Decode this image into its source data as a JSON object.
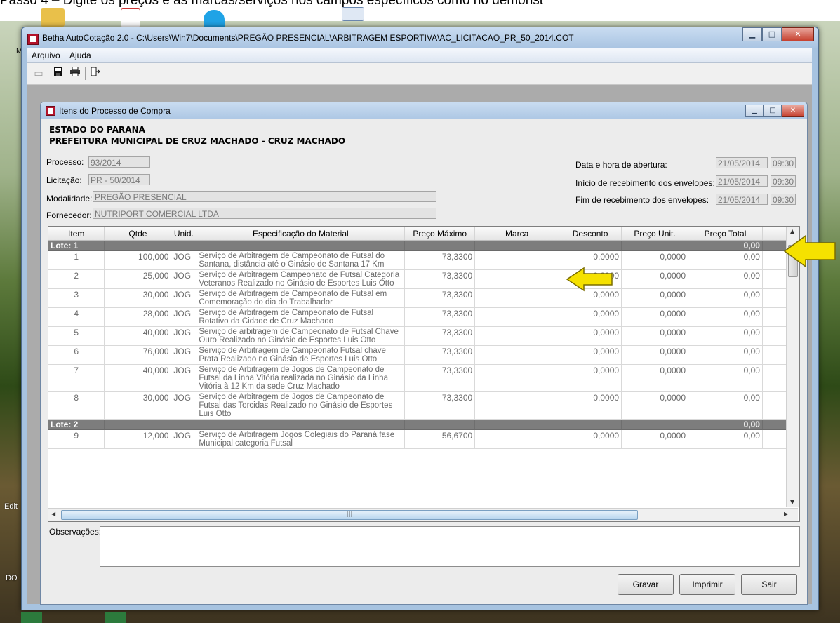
{
  "banner": {
    "text": "Passo 4 – Digite os preços e as marcas/serviços nos campos específicos como no demonst"
  },
  "desktop": {
    "labels": [
      "M",
      "Edit",
      "DO"
    ]
  },
  "window": {
    "title": "Betha AutoCotação 2.0 - C:\\Users\\Win7\\Documents\\PREGÃO PRESENCIAL\\ARBITRAGEM ESPORTIVA\\AC_LICITACAO_PR_50_2014.COT",
    "menu": [
      "Arquivo",
      "Ajuda"
    ],
    "toolbar": [
      "open-folder-icon",
      "save-icon",
      "print-icon",
      "exit-icon"
    ]
  },
  "child": {
    "title": "Itens do Processo de Compra",
    "header_line1": "ESTADO DO PARANA",
    "header_line2": "PREFEITURA MUNICIPAL DE CRUZ MACHADO - CRUZ MACHADO",
    "fields": {
      "processo_label": "Processo:",
      "processo": "93/2014",
      "licitacao_label": "Licitação:",
      "licitacao": "PR - 50/2014",
      "modalidade_label": "Modalidade:",
      "modalidade": "PREGÃO PRESENCIAL",
      "fornecedor_label": "Fornecedor:",
      "fornecedor": "NUTRIPORT COMERCIAL LTDA"
    },
    "dates": {
      "abertura_label": "Data e hora de abertura:",
      "abertura_data": "21/05/2014",
      "abertura_hora": "09:30",
      "inicio_label": "Início de recebimento dos envelopes:",
      "inicio_data": "21/05/2014",
      "inicio_hora": "09:30",
      "fim_label": "Fim de recebimento dos envelopes:",
      "fim_data": "21/05/2014",
      "fim_hora": "09:30"
    },
    "grid": {
      "columns": [
        "Item",
        "Qtde",
        "Unid.",
        "Especificação do Material",
        "Preço Máximo",
        "Marca",
        "Desconto",
        "Preço Unit.",
        "Preço Total"
      ],
      "lote1": {
        "label": "Lote: 1",
        "total": "0,00"
      },
      "lote2": {
        "label": "Lote: 2",
        "total": "0,00"
      },
      "rows": [
        {
          "item": "1",
          "qtde": "100,000",
          "unid": "JOG",
          "spec": "Serviço de Arbitragem de Campeonato de Futsal do Santana, distância até o Ginásio de Santana 17 Km",
          "preco_max": "73,3300",
          "marca": "",
          "desconto": "0,0000",
          "preco_unit": "0,0000",
          "preco_total": "0,00"
        },
        {
          "item": "2",
          "qtde": "25,000",
          "unid": "JOG",
          "spec": "Serviço de Arbitragem Campeonato de Futsal Categoria Veteranos Realizado no Ginásio de Esportes Luis Otto",
          "preco_max": "73,3300",
          "marca": "",
          "desconto": "0,0000",
          "preco_unit": "0,0000",
          "preco_total": "0,00"
        },
        {
          "item": "3",
          "qtde": "30,000",
          "unid": "JOG",
          "spec": "Serviço de Arbitragem de Campeonato de Futsal em Comemoração do dia do Trabalhador",
          "preco_max": "73,3300",
          "marca": "",
          "desconto": "0,0000",
          "preco_unit": "0,0000",
          "preco_total": "0,00"
        },
        {
          "item": "4",
          "qtde": "28,000",
          "unid": "JOG",
          "spec": "Serviço de Arbitragem de Campeonato de Futsal Rotativo da Cidade de Cruz Machado",
          "preco_max": "73,3300",
          "marca": "",
          "desconto": "0,0000",
          "preco_unit": "0,0000",
          "preco_total": "0,00"
        },
        {
          "item": "5",
          "qtde": "40,000",
          "unid": "JOG",
          "spec": "Serviço de arbitragem de Campeonato de Futsal Chave Ouro Realizado no Ginásio de Esportes Luis Otto",
          "preco_max": "73,3300",
          "marca": "",
          "desconto": "0,0000",
          "preco_unit": "0,0000",
          "preco_total": "0,00"
        },
        {
          "item": "6",
          "qtde": "76,000",
          "unid": "JOG",
          "spec": "Serviço de Arbitragem de Campeonato Futsal chave Prata Realizado no Ginásio de Esportes Luis Otto",
          "preco_max": "73,3300",
          "marca": "",
          "desconto": "0,0000",
          "preco_unit": "0,0000",
          "preco_total": "0,00"
        },
        {
          "item": "7",
          "qtde": "40,000",
          "unid": "JOG",
          "spec": "Serviço de Arbitragem de Jogos de Campeonato de Futsal da Linha Vitória realizada no Ginásio da Linha Vitória à 12 Km da sede Cruz Machado",
          "preco_max": "73,3300",
          "marca": "",
          "desconto": "0,0000",
          "preco_unit": "0,0000",
          "preco_total": "0,00"
        },
        {
          "item": "8",
          "qtde": "30,000",
          "unid": "JOG",
          "spec": "Serviço de Arbitragem de Jogos de Campeonato de Futsal das Torcidas Realizado no Ginásio de Esportes Luis Otto",
          "preco_max": "73,3300",
          "marca": "",
          "desconto": "0,0000",
          "preco_unit": "0,0000",
          "preco_total": "0,00"
        },
        {
          "item": "9",
          "qtde": "12,000",
          "unid": "JOG",
          "spec": "Serviço de Arbitragem Jogos Colegiais do Paraná fase Municipal categoria Futsal",
          "preco_max": "56,6700",
          "marca": "",
          "desconto": "0,0000",
          "preco_unit": "0,0000",
          "preco_total": "0,00"
        }
      ]
    },
    "observacoes_label": "Observações:",
    "observacoes": "",
    "buttons": {
      "gravar": "Gravar",
      "imprimir": "Imprimir",
      "sair": "Sair"
    }
  },
  "colors": {
    "arrow": "#f5e100",
    "lote_bg": "#7d7d7d"
  }
}
